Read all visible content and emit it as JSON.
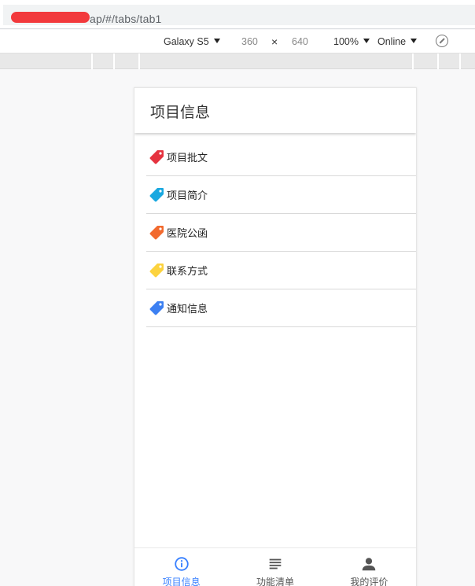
{
  "browser": {
    "url_text": "ap/#/tabs/tab1"
  },
  "device_toolbar": {
    "device": "Galaxy S5",
    "width": "360",
    "separator": "×",
    "height": "640",
    "zoom": "100%",
    "network": "Online"
  },
  "app": {
    "title": "项目信息",
    "items": [
      {
        "label": "项目批文",
        "icon": "tag-icon",
        "color": "#e5333f"
      },
      {
        "label": "项目简介",
        "icon": "tag-icon",
        "color": "#19a8e0"
      },
      {
        "label": "医院公函",
        "icon": "tag-icon",
        "color": "#f26a2e"
      },
      {
        "label": "联系方式",
        "icon": "tag-icon",
        "color": "#fcd33f"
      },
      {
        "label": "通知信息",
        "icon": "tag-icon",
        "color": "#3c80f2"
      }
    ],
    "tabs": [
      {
        "label": "项目信息",
        "icon": "info-circle-icon",
        "active": true
      },
      {
        "label": "功能清单",
        "icon": "list-lines-icon",
        "active": false
      },
      {
        "label": "我的评价",
        "icon": "person-icon",
        "active": false
      }
    ],
    "colors": {
      "accent": "#3880ff",
      "inactive": "#555555"
    }
  }
}
